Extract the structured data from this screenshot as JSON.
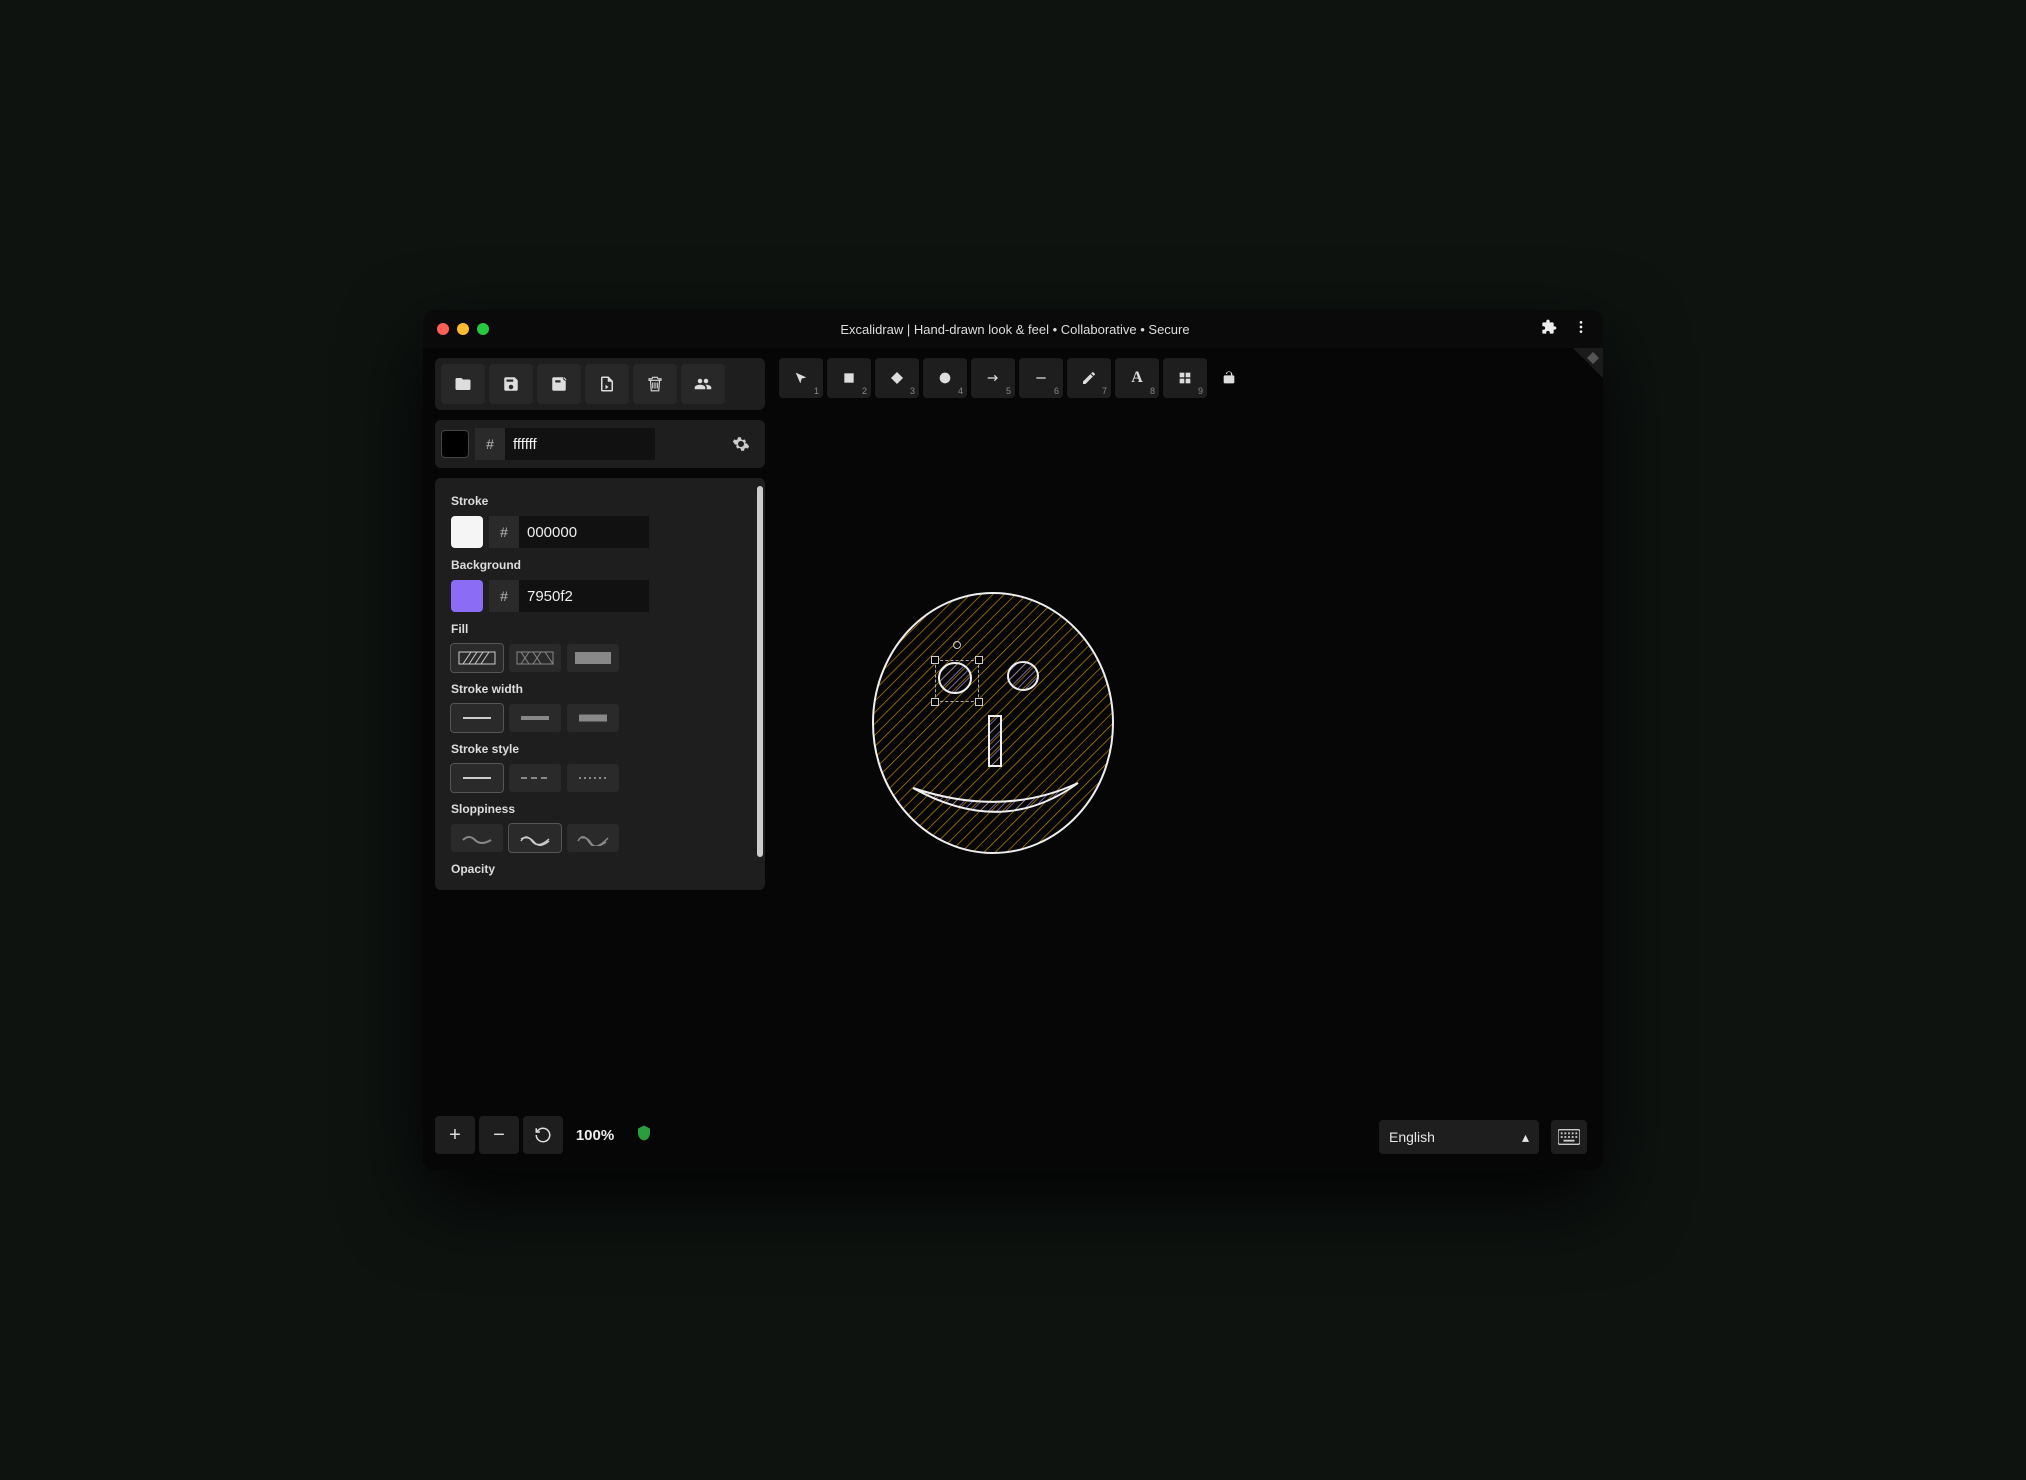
{
  "window": {
    "title": "Excalidraw | Hand-drawn look & feel • Collaborative • Secure"
  },
  "canvas_color": {
    "hash": "#",
    "value": "ffffff",
    "swatch": "#000000"
  },
  "tools": [
    {
      "name": "select",
      "num": "1"
    },
    {
      "name": "rectangle",
      "num": "2"
    },
    {
      "name": "diamond",
      "num": "3"
    },
    {
      "name": "ellipse",
      "num": "4"
    },
    {
      "name": "arrow",
      "num": "5"
    },
    {
      "name": "line",
      "num": "6"
    },
    {
      "name": "draw",
      "num": "7"
    },
    {
      "name": "text",
      "label": "A",
      "num": "8"
    },
    {
      "name": "library",
      "num": "9"
    }
  ],
  "props": {
    "stroke_label": "Stroke",
    "stroke_hash": "#",
    "stroke_value": "000000",
    "stroke_swatch": "#f5f5f5",
    "background_label": "Background",
    "background_hash": "#",
    "background_value": "7950f2",
    "background_swatch": "#7950f2",
    "fill_label": "Fill",
    "stroke_width_label": "Stroke width",
    "stroke_style_label": "Stroke style",
    "sloppiness_label": "Sloppiness",
    "opacity_label": "Opacity"
  },
  "footer": {
    "zoom": "100%",
    "language": "English"
  }
}
